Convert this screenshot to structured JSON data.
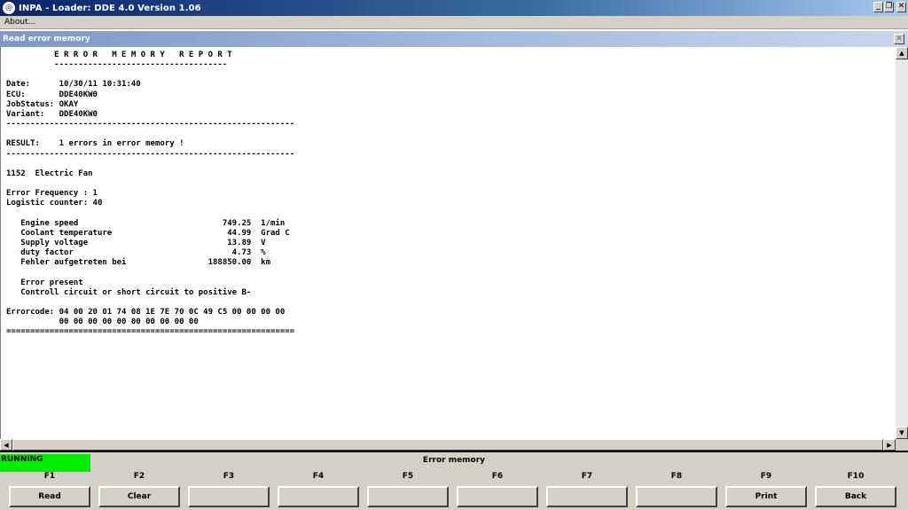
{
  "window": {
    "title": "INPA - Loader:  DDE 4.0 Version 1.06",
    "menu": [
      "About..."
    ]
  },
  "child_window": {
    "title": "Read error memory"
  },
  "report": {
    "lines": [
      "          E R R O R   M E M O R Y   R E P O R T",
      "          ------------------------------------",
      "",
      "Date:      10/30/11 10:31:40",
      "ECU:       DDE40KW0",
      "JobStatus: OKAY",
      "Variant:   DDE40KW0",
      "------------------------------------------------------------",
      "",
      "RESULT:    1 errors in error memory !",
      "------------------------------------------------------------",
      "",
      "1152  Electric Fan",
      "",
      "Error Frequency : 1",
      "Logistic counter: 40",
      "",
      "   Engine speed                              749.25  1/min",
      "   Coolant temperature                        44.99  Grad C",
      "   Supply voltage                             13.89  V",
      "   duty factor                                 4.73  %",
      "   Fehler aufgetreten bei                 188850.00  km",
      "",
      "   Error present",
      "   Controll circuit or short circuit to positive B-",
      "",
      "Errorcode: 04 00 20 01 74 08 1E 7E 70 0C 49 C5 00 00 00 00",
      "           00 00 00 00 00 00 00 00 00 00",
      "============================================================"
    ]
  },
  "status": {
    "state": "RUNNING",
    "state_color": "#00ee00",
    "message": "Error memory"
  },
  "function_keys": [
    {
      "key": "F1",
      "label": "Read"
    },
    {
      "key": "F2",
      "label": "Clear"
    },
    {
      "key": "F3",
      "label": ""
    },
    {
      "key": "F4",
      "label": ""
    },
    {
      "key": "F5",
      "label": ""
    },
    {
      "key": "F6",
      "label": ""
    },
    {
      "key": "F7",
      "label": ""
    },
    {
      "key": "F8",
      "label": ""
    },
    {
      "key": "F9",
      "label": "Print"
    },
    {
      "key": "F10",
      "label": "Back"
    }
  ]
}
